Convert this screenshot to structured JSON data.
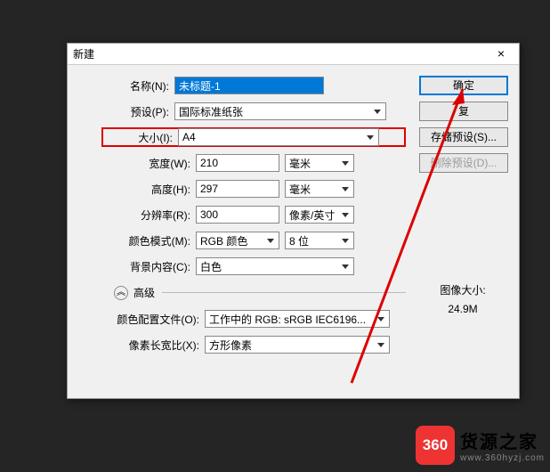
{
  "dialog": {
    "title": "新建",
    "close": "×"
  },
  "fields": {
    "name": {
      "label": "名称(N):",
      "value": "未标题-1"
    },
    "preset": {
      "label": "预设(P):",
      "value": "国际标准纸张"
    },
    "size": {
      "label": "大小(I):",
      "value": "A4"
    },
    "width": {
      "label": "宽度(W):",
      "value": "210",
      "unit": "毫米"
    },
    "height": {
      "label": "高度(H):",
      "value": "297",
      "unit": "毫米"
    },
    "resolution": {
      "label": "分辨率(R):",
      "value": "300",
      "unit": "像素/英寸"
    },
    "colormode": {
      "label": "颜色模式(M):",
      "value": "RGB 颜色",
      "depth": "8 位"
    },
    "bgcontent": {
      "label": "背景内容(C):",
      "value": "白色"
    }
  },
  "advanced": {
    "label": "高级",
    "profile": {
      "label": "颜色配置文件(O):",
      "value": "工作中的 RGB: sRGB IEC6196..."
    },
    "aspect": {
      "label": "像素长宽比(X):",
      "value": "方形像素"
    }
  },
  "buttons": {
    "ok": "确定",
    "cancel": "复",
    "save": "存储预设(S)...",
    "delete": "删除预设(D)..."
  },
  "imagesize": {
    "label": "图像大小:",
    "value": "24.9M"
  },
  "watermark": {
    "badge": "360",
    "title": "货源之家",
    "url": "www.360hyzj.com"
  }
}
